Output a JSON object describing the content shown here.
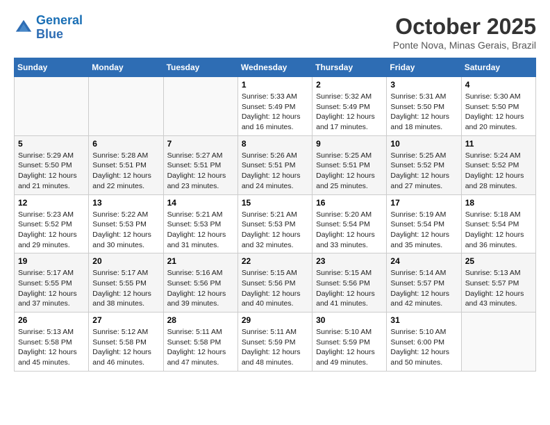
{
  "logo": {
    "text_general": "General",
    "text_blue": "Blue"
  },
  "header": {
    "title": "October 2025",
    "subtitle": "Ponte Nova, Minas Gerais, Brazil"
  },
  "weekdays": [
    "Sunday",
    "Monday",
    "Tuesday",
    "Wednesday",
    "Thursday",
    "Friday",
    "Saturday"
  ],
  "weeks": [
    [
      {
        "day": "",
        "info": ""
      },
      {
        "day": "",
        "info": ""
      },
      {
        "day": "",
        "info": ""
      },
      {
        "day": "1",
        "info": "Sunrise: 5:33 AM\nSunset: 5:49 PM\nDaylight: 12 hours\nand 16 minutes."
      },
      {
        "day": "2",
        "info": "Sunrise: 5:32 AM\nSunset: 5:49 PM\nDaylight: 12 hours\nand 17 minutes."
      },
      {
        "day": "3",
        "info": "Sunrise: 5:31 AM\nSunset: 5:50 PM\nDaylight: 12 hours\nand 18 minutes."
      },
      {
        "day": "4",
        "info": "Sunrise: 5:30 AM\nSunset: 5:50 PM\nDaylight: 12 hours\nand 20 minutes."
      }
    ],
    [
      {
        "day": "5",
        "info": "Sunrise: 5:29 AM\nSunset: 5:50 PM\nDaylight: 12 hours\nand 21 minutes."
      },
      {
        "day": "6",
        "info": "Sunrise: 5:28 AM\nSunset: 5:51 PM\nDaylight: 12 hours\nand 22 minutes."
      },
      {
        "day": "7",
        "info": "Sunrise: 5:27 AM\nSunset: 5:51 PM\nDaylight: 12 hours\nand 23 minutes."
      },
      {
        "day": "8",
        "info": "Sunrise: 5:26 AM\nSunset: 5:51 PM\nDaylight: 12 hours\nand 24 minutes."
      },
      {
        "day": "9",
        "info": "Sunrise: 5:25 AM\nSunset: 5:51 PM\nDaylight: 12 hours\nand 25 minutes."
      },
      {
        "day": "10",
        "info": "Sunrise: 5:25 AM\nSunset: 5:52 PM\nDaylight: 12 hours\nand 27 minutes."
      },
      {
        "day": "11",
        "info": "Sunrise: 5:24 AM\nSunset: 5:52 PM\nDaylight: 12 hours\nand 28 minutes."
      }
    ],
    [
      {
        "day": "12",
        "info": "Sunrise: 5:23 AM\nSunset: 5:52 PM\nDaylight: 12 hours\nand 29 minutes."
      },
      {
        "day": "13",
        "info": "Sunrise: 5:22 AM\nSunset: 5:53 PM\nDaylight: 12 hours\nand 30 minutes."
      },
      {
        "day": "14",
        "info": "Sunrise: 5:21 AM\nSunset: 5:53 PM\nDaylight: 12 hours\nand 31 minutes."
      },
      {
        "day": "15",
        "info": "Sunrise: 5:21 AM\nSunset: 5:53 PM\nDaylight: 12 hours\nand 32 minutes."
      },
      {
        "day": "16",
        "info": "Sunrise: 5:20 AM\nSunset: 5:54 PM\nDaylight: 12 hours\nand 33 minutes."
      },
      {
        "day": "17",
        "info": "Sunrise: 5:19 AM\nSunset: 5:54 PM\nDaylight: 12 hours\nand 35 minutes."
      },
      {
        "day": "18",
        "info": "Sunrise: 5:18 AM\nSunset: 5:54 PM\nDaylight: 12 hours\nand 36 minutes."
      }
    ],
    [
      {
        "day": "19",
        "info": "Sunrise: 5:17 AM\nSunset: 5:55 PM\nDaylight: 12 hours\nand 37 minutes."
      },
      {
        "day": "20",
        "info": "Sunrise: 5:17 AM\nSunset: 5:55 PM\nDaylight: 12 hours\nand 38 minutes."
      },
      {
        "day": "21",
        "info": "Sunrise: 5:16 AM\nSunset: 5:56 PM\nDaylight: 12 hours\nand 39 minutes."
      },
      {
        "day": "22",
        "info": "Sunrise: 5:15 AM\nSunset: 5:56 PM\nDaylight: 12 hours\nand 40 minutes."
      },
      {
        "day": "23",
        "info": "Sunrise: 5:15 AM\nSunset: 5:56 PM\nDaylight: 12 hours\nand 41 minutes."
      },
      {
        "day": "24",
        "info": "Sunrise: 5:14 AM\nSunset: 5:57 PM\nDaylight: 12 hours\nand 42 minutes."
      },
      {
        "day": "25",
        "info": "Sunrise: 5:13 AM\nSunset: 5:57 PM\nDaylight: 12 hours\nand 43 minutes."
      }
    ],
    [
      {
        "day": "26",
        "info": "Sunrise: 5:13 AM\nSunset: 5:58 PM\nDaylight: 12 hours\nand 45 minutes."
      },
      {
        "day": "27",
        "info": "Sunrise: 5:12 AM\nSunset: 5:58 PM\nDaylight: 12 hours\nand 46 minutes."
      },
      {
        "day": "28",
        "info": "Sunrise: 5:11 AM\nSunset: 5:58 PM\nDaylight: 12 hours\nand 47 minutes."
      },
      {
        "day": "29",
        "info": "Sunrise: 5:11 AM\nSunset: 5:59 PM\nDaylight: 12 hours\nand 48 minutes."
      },
      {
        "day": "30",
        "info": "Sunrise: 5:10 AM\nSunset: 5:59 PM\nDaylight: 12 hours\nand 49 minutes."
      },
      {
        "day": "31",
        "info": "Sunrise: 5:10 AM\nSunset: 6:00 PM\nDaylight: 12 hours\nand 50 minutes."
      },
      {
        "day": "",
        "info": ""
      }
    ]
  ]
}
